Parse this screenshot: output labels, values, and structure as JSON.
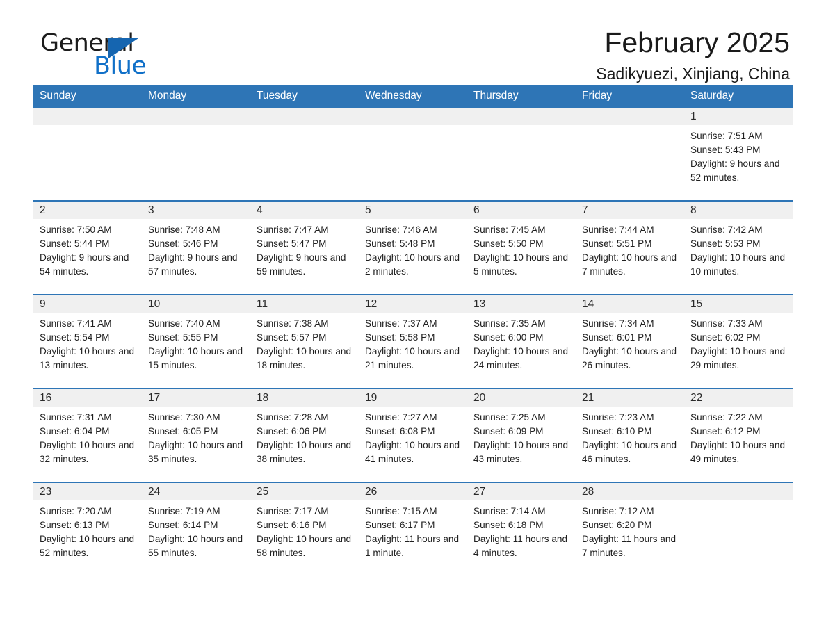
{
  "brand": {
    "name_part1": "General",
    "name_part2": "Blue",
    "triangle_color": "#1565b0",
    "blue_color": "#1070c8"
  },
  "header": {
    "title": "February 2025",
    "subtitle": "Sadikyuezi, Xinjiang, China"
  },
  "theme": {
    "header_blue": "#2e75b6",
    "daynum_gray": "#f0f0f0"
  },
  "weekdays": [
    "Sunday",
    "Monday",
    "Tuesday",
    "Wednesday",
    "Thursday",
    "Friday",
    "Saturday"
  ],
  "weeks": [
    [
      {
        "day": ""
      },
      {
        "day": ""
      },
      {
        "day": ""
      },
      {
        "day": ""
      },
      {
        "day": ""
      },
      {
        "day": ""
      },
      {
        "day": "1",
        "sunrise": "Sunrise: 7:51 AM",
        "sunset": "Sunset: 5:43 PM",
        "daylight": "Daylight: 9 hours and 52 minutes."
      }
    ],
    [
      {
        "day": "2",
        "sunrise": "Sunrise: 7:50 AM",
        "sunset": "Sunset: 5:44 PM",
        "daylight": "Daylight: 9 hours and 54 minutes."
      },
      {
        "day": "3",
        "sunrise": "Sunrise: 7:48 AM",
        "sunset": "Sunset: 5:46 PM",
        "daylight": "Daylight: 9 hours and 57 minutes."
      },
      {
        "day": "4",
        "sunrise": "Sunrise: 7:47 AM",
        "sunset": "Sunset: 5:47 PM",
        "daylight": "Daylight: 9 hours and 59 minutes."
      },
      {
        "day": "5",
        "sunrise": "Sunrise: 7:46 AM",
        "sunset": "Sunset: 5:48 PM",
        "daylight": "Daylight: 10 hours and 2 minutes."
      },
      {
        "day": "6",
        "sunrise": "Sunrise: 7:45 AM",
        "sunset": "Sunset: 5:50 PM",
        "daylight": "Daylight: 10 hours and 5 minutes."
      },
      {
        "day": "7",
        "sunrise": "Sunrise: 7:44 AM",
        "sunset": "Sunset: 5:51 PM",
        "daylight": "Daylight: 10 hours and 7 minutes."
      },
      {
        "day": "8",
        "sunrise": "Sunrise: 7:42 AM",
        "sunset": "Sunset: 5:53 PM",
        "daylight": "Daylight: 10 hours and 10 minutes."
      }
    ],
    [
      {
        "day": "9",
        "sunrise": "Sunrise: 7:41 AM",
        "sunset": "Sunset: 5:54 PM",
        "daylight": "Daylight: 10 hours and 13 minutes."
      },
      {
        "day": "10",
        "sunrise": "Sunrise: 7:40 AM",
        "sunset": "Sunset: 5:55 PM",
        "daylight": "Daylight: 10 hours and 15 minutes."
      },
      {
        "day": "11",
        "sunrise": "Sunrise: 7:38 AM",
        "sunset": "Sunset: 5:57 PM",
        "daylight": "Daylight: 10 hours and 18 minutes."
      },
      {
        "day": "12",
        "sunrise": "Sunrise: 7:37 AM",
        "sunset": "Sunset: 5:58 PM",
        "daylight": "Daylight: 10 hours and 21 minutes."
      },
      {
        "day": "13",
        "sunrise": "Sunrise: 7:35 AM",
        "sunset": "Sunset: 6:00 PM",
        "daylight": "Daylight: 10 hours and 24 minutes."
      },
      {
        "day": "14",
        "sunrise": "Sunrise: 7:34 AM",
        "sunset": "Sunset: 6:01 PM",
        "daylight": "Daylight: 10 hours and 26 minutes."
      },
      {
        "day": "15",
        "sunrise": "Sunrise: 7:33 AM",
        "sunset": "Sunset: 6:02 PM",
        "daylight": "Daylight: 10 hours and 29 minutes."
      }
    ],
    [
      {
        "day": "16",
        "sunrise": "Sunrise: 7:31 AM",
        "sunset": "Sunset: 6:04 PM",
        "daylight": "Daylight: 10 hours and 32 minutes."
      },
      {
        "day": "17",
        "sunrise": "Sunrise: 7:30 AM",
        "sunset": "Sunset: 6:05 PM",
        "daylight": "Daylight: 10 hours and 35 minutes."
      },
      {
        "day": "18",
        "sunrise": "Sunrise: 7:28 AM",
        "sunset": "Sunset: 6:06 PM",
        "daylight": "Daylight: 10 hours and 38 minutes."
      },
      {
        "day": "19",
        "sunrise": "Sunrise: 7:27 AM",
        "sunset": "Sunset: 6:08 PM",
        "daylight": "Daylight: 10 hours and 41 minutes."
      },
      {
        "day": "20",
        "sunrise": "Sunrise: 7:25 AM",
        "sunset": "Sunset: 6:09 PM",
        "daylight": "Daylight: 10 hours and 43 minutes."
      },
      {
        "day": "21",
        "sunrise": "Sunrise: 7:23 AM",
        "sunset": "Sunset: 6:10 PM",
        "daylight": "Daylight: 10 hours and 46 minutes."
      },
      {
        "day": "22",
        "sunrise": "Sunrise: 7:22 AM",
        "sunset": "Sunset: 6:12 PM",
        "daylight": "Daylight: 10 hours and 49 minutes."
      }
    ],
    [
      {
        "day": "23",
        "sunrise": "Sunrise: 7:20 AM",
        "sunset": "Sunset: 6:13 PM",
        "daylight": "Daylight: 10 hours and 52 minutes."
      },
      {
        "day": "24",
        "sunrise": "Sunrise: 7:19 AM",
        "sunset": "Sunset: 6:14 PM",
        "daylight": "Daylight: 10 hours and 55 minutes."
      },
      {
        "day": "25",
        "sunrise": "Sunrise: 7:17 AM",
        "sunset": "Sunset: 6:16 PM",
        "daylight": "Daylight: 10 hours and 58 minutes."
      },
      {
        "day": "26",
        "sunrise": "Sunrise: 7:15 AM",
        "sunset": "Sunset: 6:17 PM",
        "daylight": "Daylight: 11 hours and 1 minute."
      },
      {
        "day": "27",
        "sunrise": "Sunrise: 7:14 AM",
        "sunset": "Sunset: 6:18 PM",
        "daylight": "Daylight: 11 hours and 4 minutes."
      },
      {
        "day": "28",
        "sunrise": "Sunrise: 7:12 AM",
        "sunset": "Sunset: 6:20 PM",
        "daylight": "Daylight: 11 hours and 7 minutes."
      },
      {
        "day": ""
      }
    ]
  ]
}
